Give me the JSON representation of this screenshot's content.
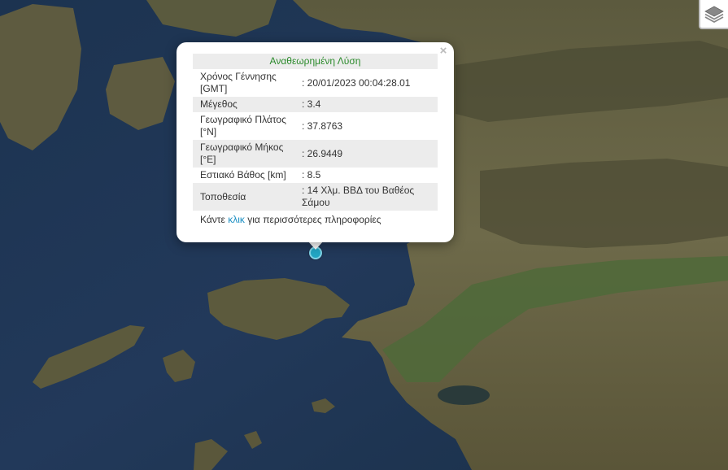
{
  "popup": {
    "header": "Αναθεωρημένη Λύση",
    "close_symbol": "×",
    "rows": [
      {
        "label": "Χρόνος Γέννησης [GMT]",
        "value": ": 20/01/2023 00:04:28.01"
      },
      {
        "label": "Μέγεθος",
        "value": ": 3.4"
      },
      {
        "label": "Γεωγραφικό Πλάτος [°N]",
        "value": ": 37.8763"
      },
      {
        "label": "Γεωγραφικό Μήκος [°E]",
        "value": ": 26.9449"
      },
      {
        "label": "Εστιακό Βάθος [km]",
        "value": ": 8.5"
      },
      {
        "label": "Τοποθεσία",
        "value": ": 14 Χλμ. ΒΒΔ του Βαθέος Σάμου"
      }
    ],
    "footer_prefix": "Κάντε",
    "footer_link": "κλικ",
    "footer_suffix": "για περισσότερες πληροφορίες"
  },
  "controls": {
    "layers_icon": "layers-icon"
  },
  "colors": {
    "sea": "#1f3550",
    "marker": "#22a6c4",
    "header_text": "#2b8a2b",
    "link": "#1a8ec2"
  }
}
